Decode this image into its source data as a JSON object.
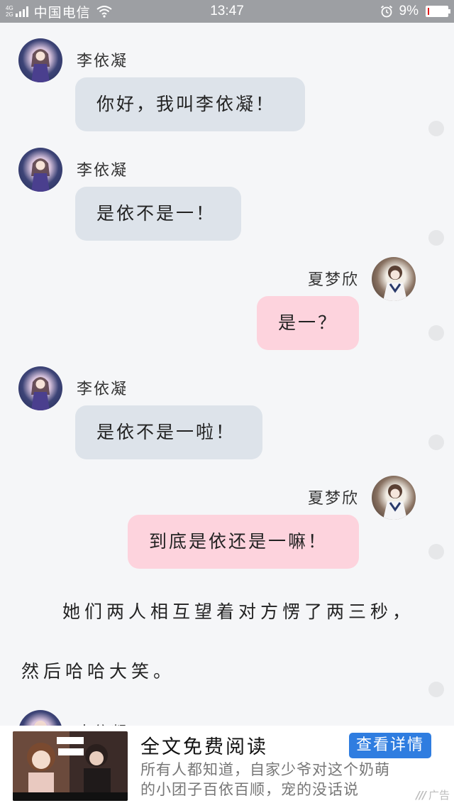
{
  "status_bar": {
    "network_top": "4G",
    "network_bottom": "2G",
    "carrier": "中国电信",
    "time": "13:47",
    "battery_percent": "9%",
    "battery_level": 0.09,
    "battery_color": "#e21b1b",
    "icons": [
      "signal-icon",
      "wifi-icon",
      "alarm-icon",
      "battery-icon"
    ]
  },
  "messages": [
    {
      "side": "left",
      "name": "李依凝",
      "text": "你好，我叫李依凝！"
    },
    {
      "side": "left",
      "name": "李依凝",
      "text": "是依不是一！"
    },
    {
      "side": "right",
      "name": "夏梦欣",
      "text": "是一？"
    },
    {
      "side": "left",
      "name": "李依凝",
      "text": "是依不是一啦！"
    },
    {
      "side": "right",
      "name": "夏梦欣",
      "text": "到底是依还是一嘛！"
    }
  ],
  "narration": {
    "line1": "她们两人相互望着对方愣了两三秒，",
    "line2": "然后哈哈大笑。"
  },
  "partial_next_name": "李依凝",
  "colors": {
    "left_bubble": "#dde3ea",
    "right_bubble": "#fdd3dd",
    "ad_button": "#2f7de0"
  },
  "ad": {
    "title": "全文免费阅读",
    "button_label": "查看详情",
    "description_line1": "所有人都知道，自家少爷对这个奶萌",
    "description_line2": "的小团子百依百顺，宠的没话说",
    "label": "广告",
    "label_mark": "///"
  }
}
